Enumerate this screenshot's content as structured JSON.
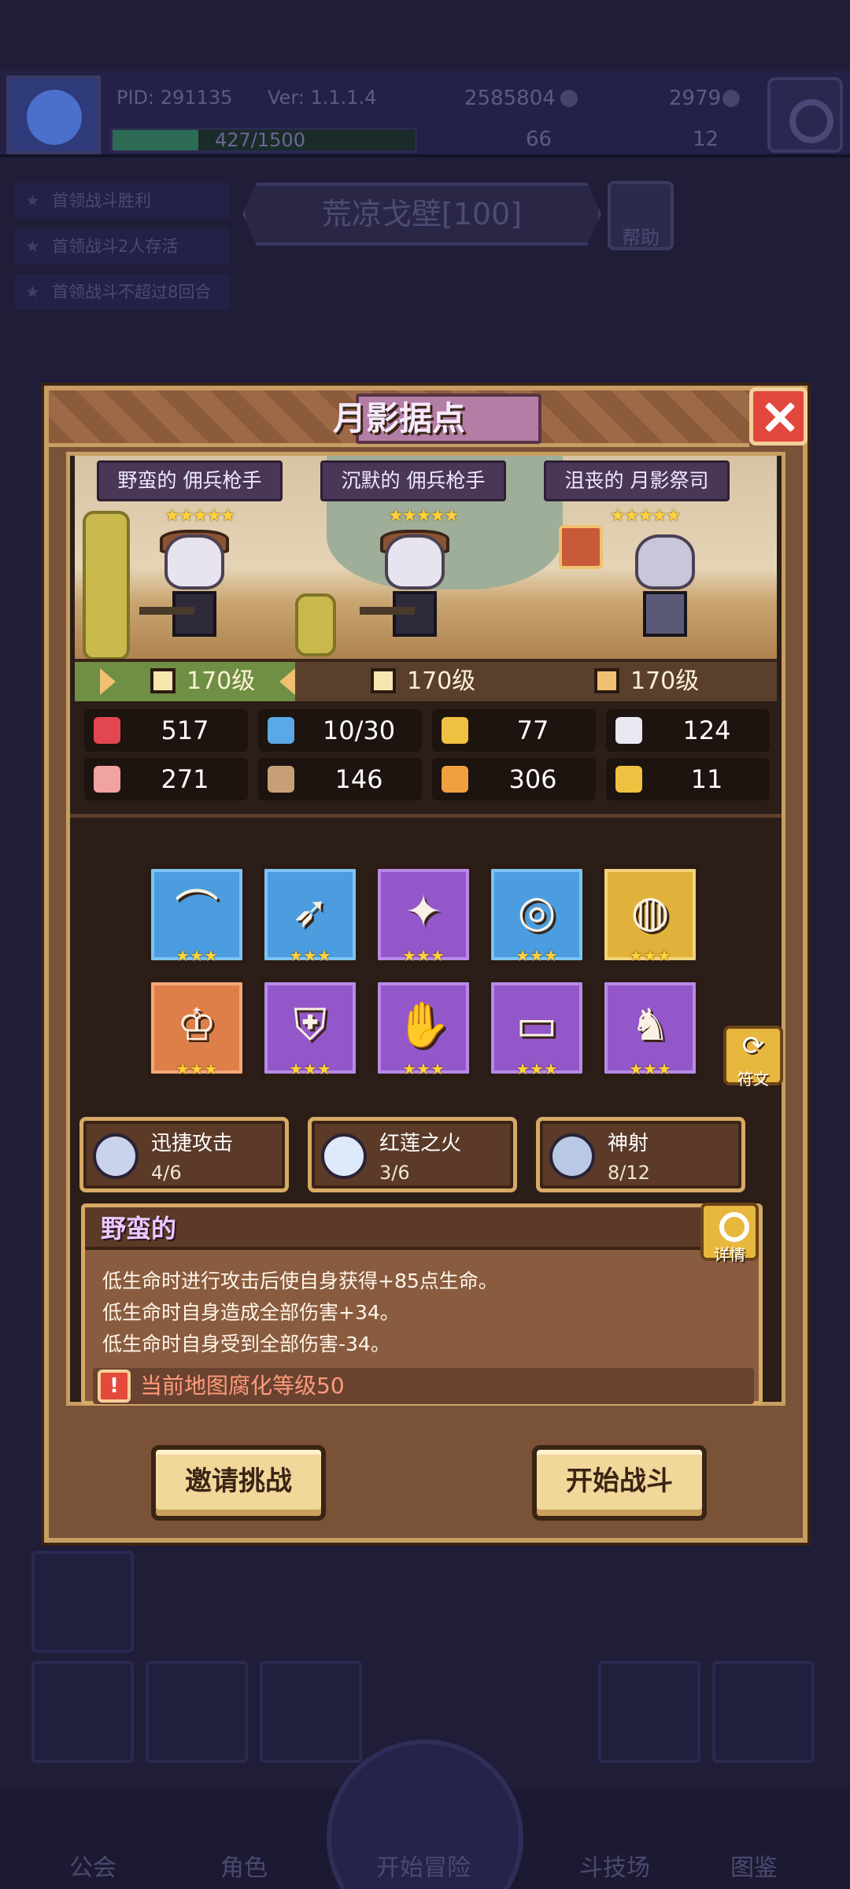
{
  "header": {
    "pid": "PID: 291135",
    "version": "Ver: 1.1.1.4",
    "exp": "427/1500",
    "exp_fraction": 0.285,
    "gold": "2585804",
    "gems": "2979",
    "res_a": "66",
    "res_b": "12"
  },
  "quests": [
    "首领战斗胜利",
    "首领战斗2人存活",
    "首领战斗不超过8回合"
  ],
  "stage": {
    "name": "荒凉戈壁[100]",
    "help_label": "帮助"
  },
  "bottom_nav": [
    "公会",
    "角色",
    "开始冒险",
    "斗技场",
    "图鉴"
  ],
  "modal": {
    "title": "月影据点",
    "enemies": [
      {
        "name": "野蛮的 佣兵枪手",
        "stars": "★★★★★",
        "level": "170级"
      },
      {
        "name": "沉默的 佣兵枪手",
        "stars": "★★★★★",
        "level": "170级"
      },
      {
        "name": "沮丧的 月影祭司",
        "stars": "★★★★★",
        "level": "170级"
      }
    ],
    "stats": [
      {
        "icon": "heart-icon",
        "color": "#e2474f",
        "value": "517"
      },
      {
        "icon": "mana-drop-icon",
        "color": "#5aa8e6",
        "value": "10/30"
      },
      {
        "icon": "shield-icon",
        "color": "#f0c040",
        "value": "77"
      },
      {
        "icon": "wing-icon",
        "color": "#e8e8f0",
        "value": "124"
      },
      {
        "icon": "fist-icon",
        "color": "#f0a3a0",
        "value": "271"
      },
      {
        "icon": "book-icon",
        "color": "#c8a078",
        "value": "146"
      },
      {
        "icon": "scroll-icon",
        "color": "#f0a040",
        "value": "306"
      },
      {
        "icon": "horseshoe-icon",
        "color": "#f0c040",
        "value": "11"
      }
    ],
    "equipment": [
      {
        "name": "bow-icon",
        "glyph": "⌒",
        "rarity": "blue",
        "stars": "★★★"
      },
      {
        "name": "arrow-icon",
        "glyph": "➶",
        "rarity": "blue",
        "stars": "★★★"
      },
      {
        "name": "necklace-icon",
        "glyph": "✦",
        "rarity": "purple",
        "stars": "★★★"
      },
      {
        "name": "coin-icon",
        "glyph": "◎",
        "rarity": "blue",
        "stars": "★★★"
      },
      {
        "name": "ring-icon",
        "glyph": "◍",
        "rarity": "gold",
        "stars": "★★★"
      },
      {
        "name": "crown-ring-icon",
        "glyph": "♔",
        "rarity": "orange",
        "stars": "★★★"
      },
      {
        "name": "armor-icon",
        "glyph": "⛨",
        "rarity": "purple",
        "stars": "★★★"
      },
      {
        "name": "glove-icon",
        "glyph": "✋",
        "rarity": "purple",
        "stars": "★★★"
      },
      {
        "name": "belt-icon",
        "glyph": "▭",
        "rarity": "purple",
        "stars": "★★★"
      },
      {
        "name": "boots-icon",
        "glyph": "♞",
        "rarity": "purple",
        "stars": "★★★"
      }
    ],
    "rune_label": "符文",
    "skills": [
      {
        "name": "迅捷攻击",
        "count": "4/6"
      },
      {
        "name": "红莲之火",
        "count": "3/6"
      },
      {
        "name": "神射",
        "count": "8/12"
      }
    ],
    "trait": {
      "title": "野蛮的",
      "detail_label": "详情",
      "lines": [
        "低生命时进行攻击后使自身获得+85点生命。",
        "低生命时自身造成全部伤害+34。",
        "低生命时自身受到全部伤害-34。"
      ],
      "warning": "当前地图腐化等级50"
    },
    "invite_label": "邀请挑战",
    "start_label": "开始战斗"
  }
}
